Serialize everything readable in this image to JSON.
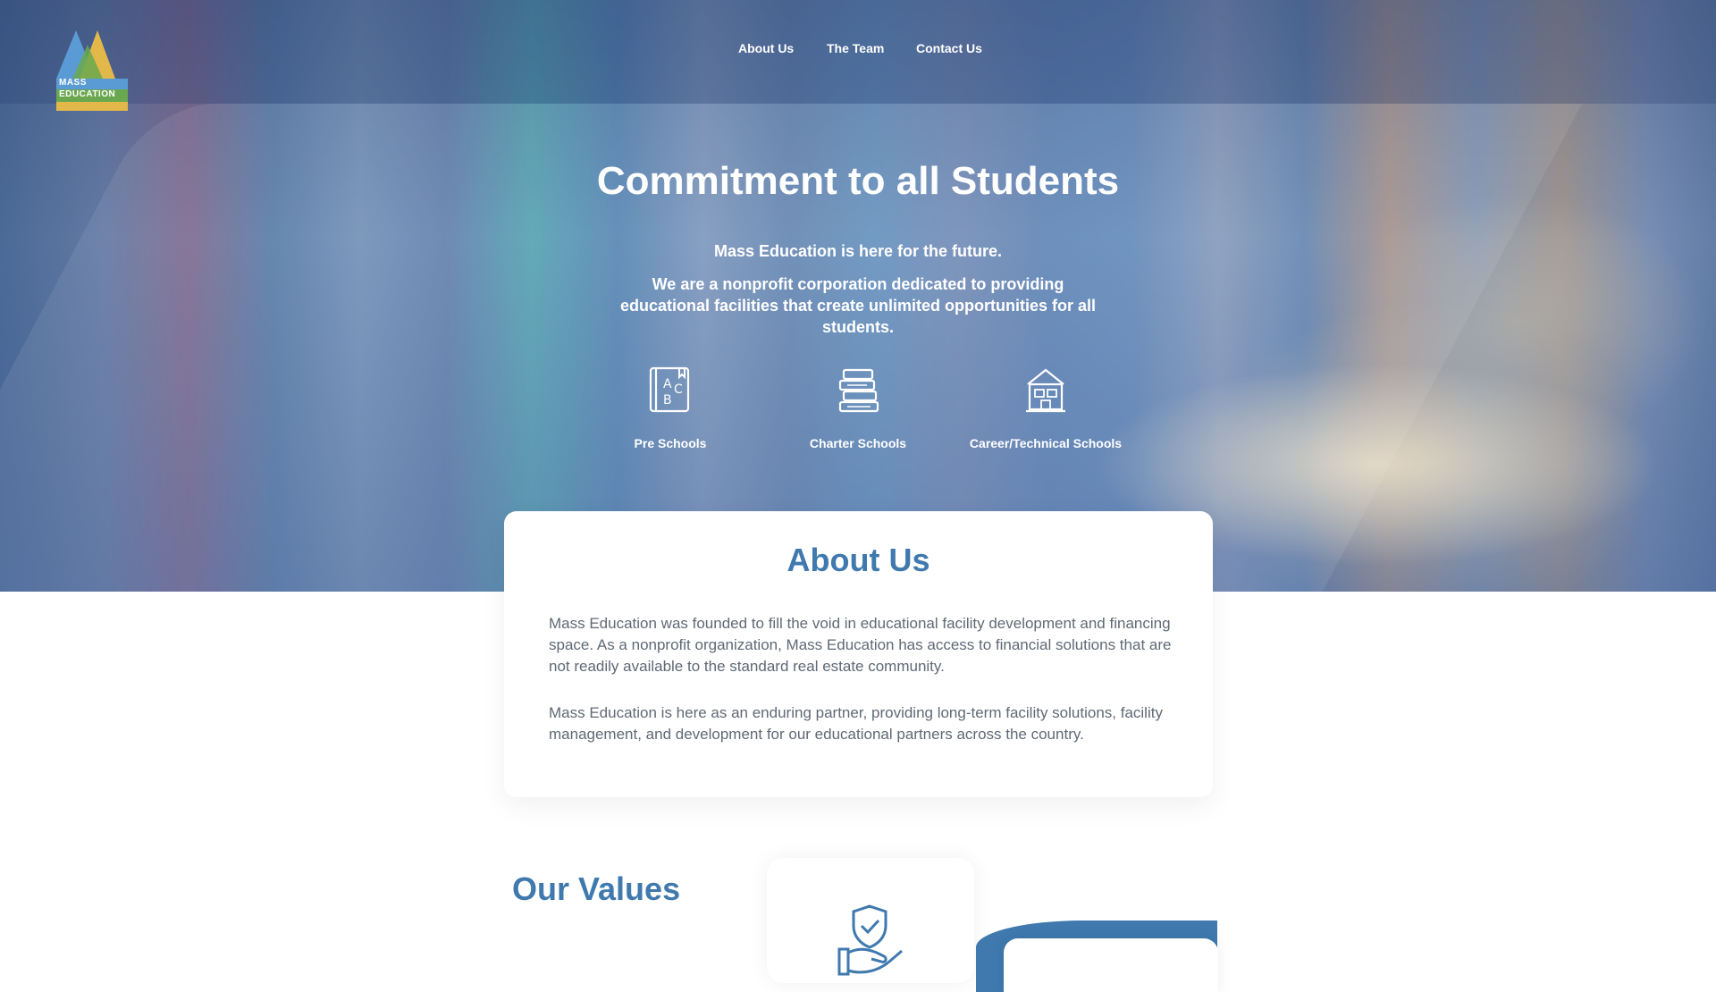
{
  "brand": {
    "logo_line1": "MASS",
    "logo_line2": "EDUCATION",
    "colors": {
      "primary_blue": "#3f79ae",
      "logo_blue": "#5b9bd5",
      "logo_gold": "#e2b84a",
      "logo_green": "#6aa84f",
      "body_text": "#606975"
    }
  },
  "nav": {
    "items": [
      {
        "label": "About Us"
      },
      {
        "label": "The Team"
      },
      {
        "label": "Contact Us"
      }
    ]
  },
  "hero": {
    "title": "Commitment to all Students",
    "subtitle": "Mass Education is here for the future.",
    "description": "We are a nonprofit corporation dedicated to providing educational facilities that create unlimited opportunities for all students.",
    "features": [
      {
        "label": "Pre Schools",
        "icon": "abc-book-icon"
      },
      {
        "label": "Charter Schools",
        "icon": "book-stack-icon"
      },
      {
        "label": "Career/Technical Schools",
        "icon": "school-building-icon"
      }
    ]
  },
  "about": {
    "title": "About Us",
    "paragraphs": [
      "Mass Education was founded to fill the void in educational facility development and financing space. As a nonprofit organization, Mass Education has access to financial solutions that are not readily available to the standard real estate community.",
      "Mass Education is here as an enduring partner, providing long-term facility solutions, facility management, and development for our educational partners across the country."
    ]
  },
  "values": {
    "title": "Our Values",
    "card_icon": "shield-check-hand-icon"
  }
}
